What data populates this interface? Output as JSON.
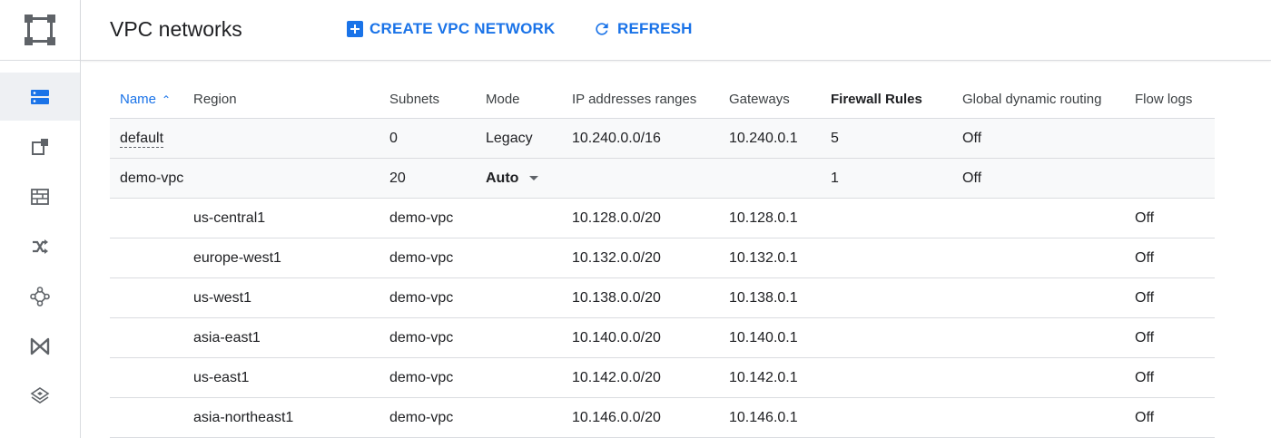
{
  "header": {
    "title": "VPC networks",
    "create_label": "CREATE VPC NETWORK",
    "refresh_label": "REFRESH"
  },
  "colors": {
    "accent": "#1a73e8",
    "rail_active": "#eef0f3",
    "icon": "#5f6368"
  },
  "rail": {
    "icons": [
      "networking-logo-icon",
      "vpc-networks-icon",
      "external-ip-icon",
      "firewall-icon",
      "routes-icon",
      "peering-icon",
      "shared-vpc-icon",
      "serverless-vpc-access-icon"
    ]
  },
  "table": {
    "columns": {
      "name": "Name",
      "region": "Region",
      "subnets": "Subnets",
      "mode": "Mode",
      "ip_ranges": "IP addresses ranges",
      "gateways": "Gateways",
      "firewall_rules": "Firewall Rules",
      "gdr": "Global dynamic routing",
      "flow_logs": "Flow logs"
    },
    "networks": [
      {
        "name": "default",
        "subnets": "0",
        "mode": "Legacy",
        "ip": "10.240.0.0/16",
        "gateway": "10.240.0.1",
        "firewall": "5",
        "gdr": "Off"
      },
      {
        "name": "demo-vpc",
        "subnets": "20",
        "mode": "Auto",
        "firewall": "1",
        "gdr": "Off"
      }
    ],
    "subnets": [
      {
        "region": "us-central1",
        "name": "demo-vpc",
        "ip": "10.128.0.0/20",
        "gateway": "10.128.0.1",
        "flow": "Off"
      },
      {
        "region": "europe-west1",
        "name": "demo-vpc",
        "ip": "10.132.0.0/20",
        "gateway": "10.132.0.1",
        "flow": "Off"
      },
      {
        "region": "us-west1",
        "name": "demo-vpc",
        "ip": "10.138.0.0/20",
        "gateway": "10.138.0.1",
        "flow": "Off"
      },
      {
        "region": "asia-east1",
        "name": "demo-vpc",
        "ip": "10.140.0.0/20",
        "gateway": "10.140.0.1",
        "flow": "Off"
      },
      {
        "region": "us-east1",
        "name": "demo-vpc",
        "ip": "10.142.0.0/20",
        "gateway": "10.142.0.1",
        "flow": "Off"
      },
      {
        "region": "asia-northeast1",
        "name": "demo-vpc",
        "ip": "10.146.0.0/20",
        "gateway": "10.146.0.1",
        "flow": "Off"
      }
    ]
  }
}
